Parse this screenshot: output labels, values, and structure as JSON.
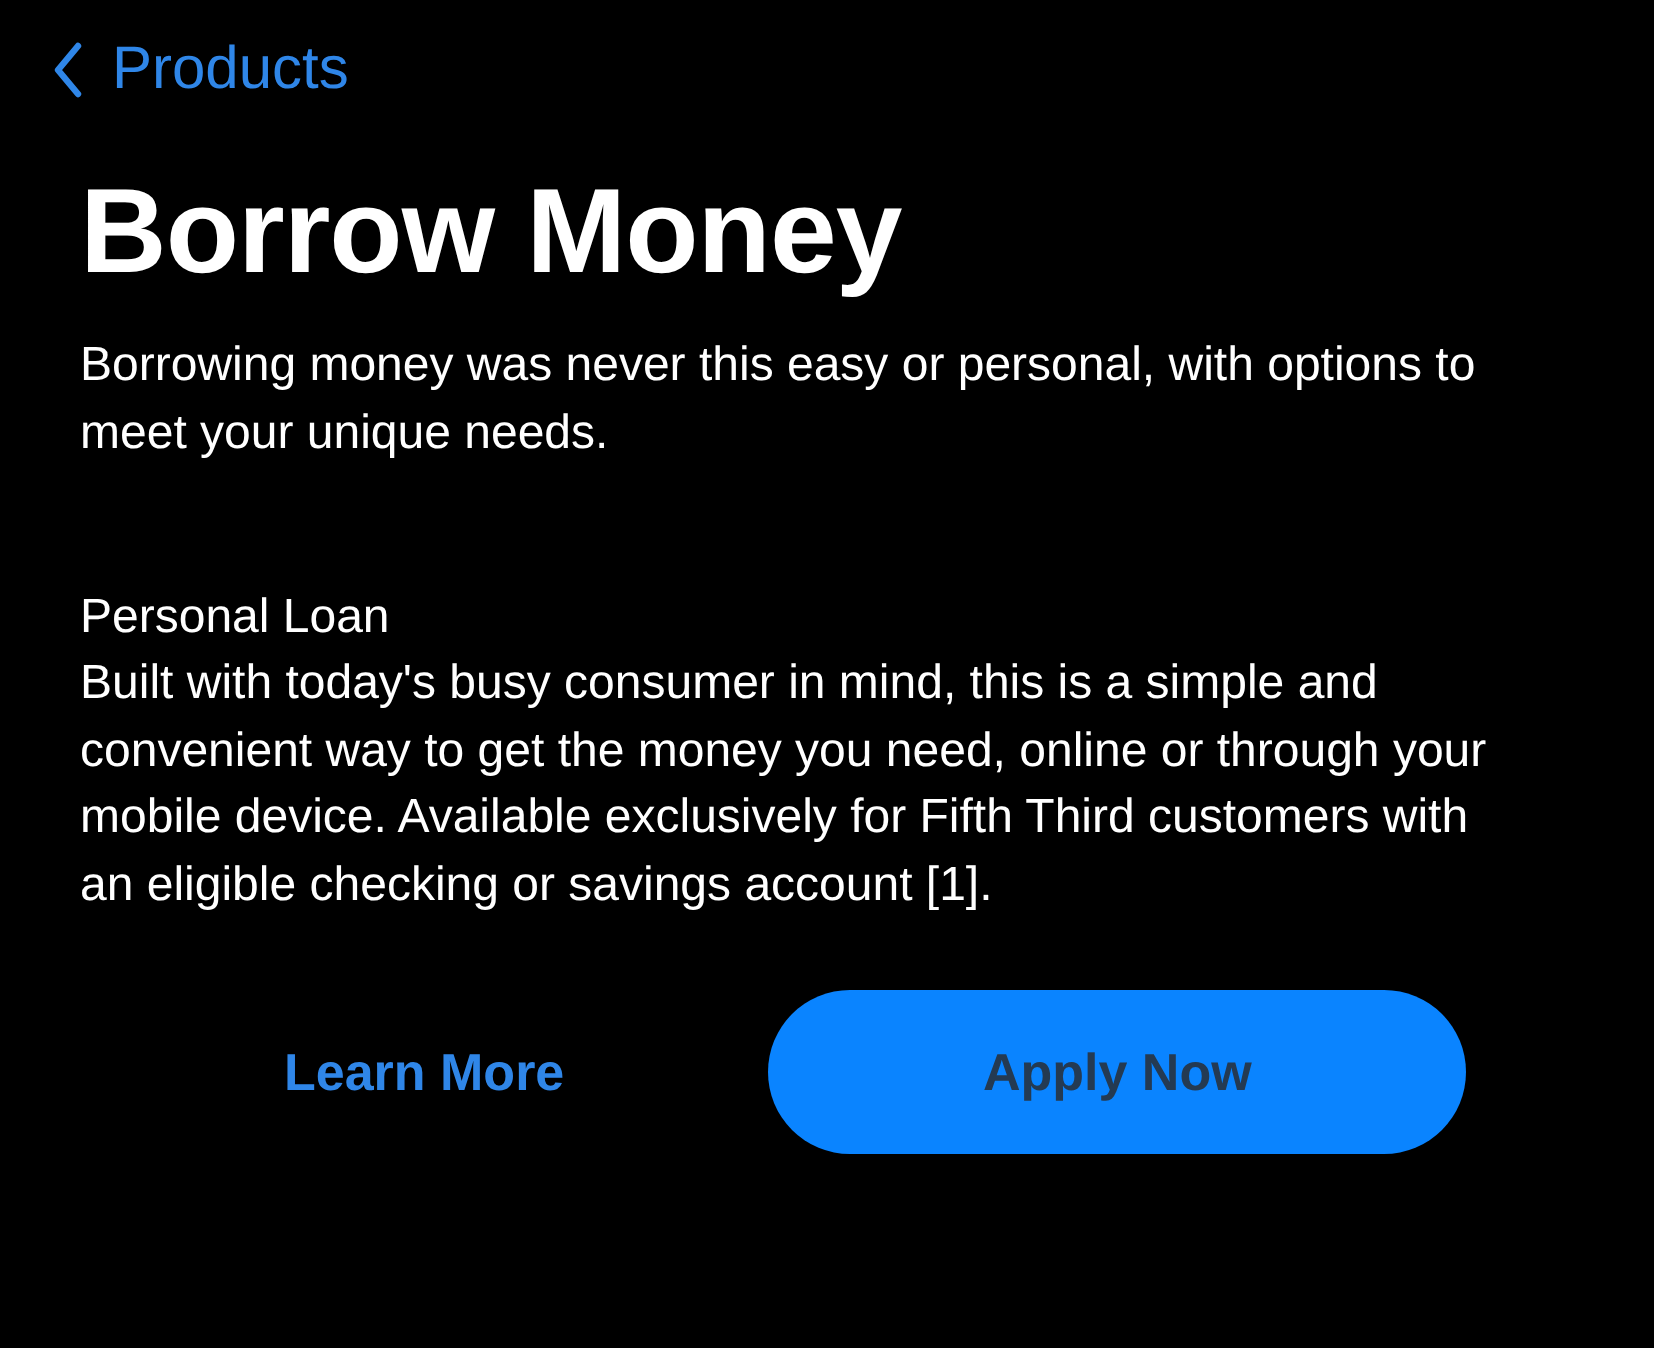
{
  "nav": {
    "back_label": "Products"
  },
  "title": "Borrow Money",
  "intro": "Borrowing money was never this easy or personal, with options to meet your unique needs.",
  "section": {
    "heading": "Personal Loan",
    "body": "Built with today's busy consumer in mind, this is a simple and convenient way to get the money you need, online or through your mobile device.  Available exclusively for Fifth Third customers with an eligible checking or savings account [1]."
  },
  "buttons": [
    {
      "label": "Learn More",
      "kind": "text"
    },
    {
      "label": "Apply Now",
      "kind": "filled"
    }
  ]
}
